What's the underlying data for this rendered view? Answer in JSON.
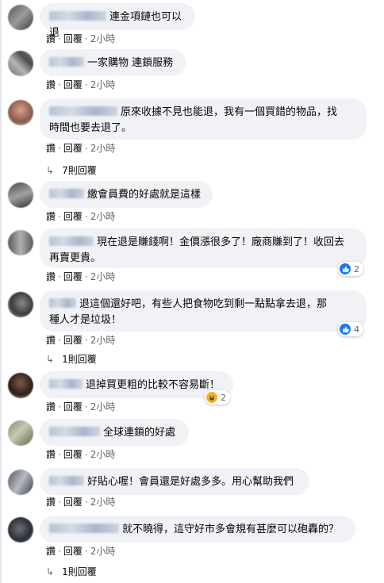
{
  "labels": {
    "like": "讚",
    "reply": "回覆",
    "dot": "·"
  },
  "comments": [
    {
      "text": "連金項鏈也可以退",
      "time": "2小時"
    },
    {
      "text": "一家購物 連鎖服務",
      "time": "2小時"
    },
    {
      "text_line1": "原來收據不見也能退，我有一個買錯的物品，找",
      "text_line2": "時間也要去退了。",
      "time": "2小時",
      "replies": "7則回覆"
    },
    {
      "text": "繳會員費的好處就是這樣",
      "time": "2小時"
    },
    {
      "text_line1": "現在退是賺錢啊！金價漲很多了！廠商賺到了！收回去",
      "text_line2": "再賣更貴。",
      "time": "2小時",
      "reaction_count": "2"
    },
    {
      "text_line1": "退這個還好吧，有些人把食物吃到剩一點點拿去退，那",
      "text_line2": "種人才是垃圾！",
      "time": "2小時",
      "reaction_count": "4",
      "replies": "1則回覆"
    },
    {
      "text": "退掉買更粗的比較不容易斷！",
      "time": "2小時",
      "reaction_count": "2"
    },
    {
      "text": "全球連鎖的好處",
      "time": "2小時"
    },
    {
      "text": "好貼心喔！會員還是好處多多。用心幫助我們",
      "time": "2小時"
    },
    {
      "text": "就不曉得，這守好市多會規有甚麼可以砲轟的？",
      "time": "2小時",
      "replies": "1則回覆"
    }
  ],
  "colors": {
    "bubble": "#f0f2f5",
    "like": "#1877f2",
    "haha": "#f7b125",
    "meta": "#65676b"
  }
}
